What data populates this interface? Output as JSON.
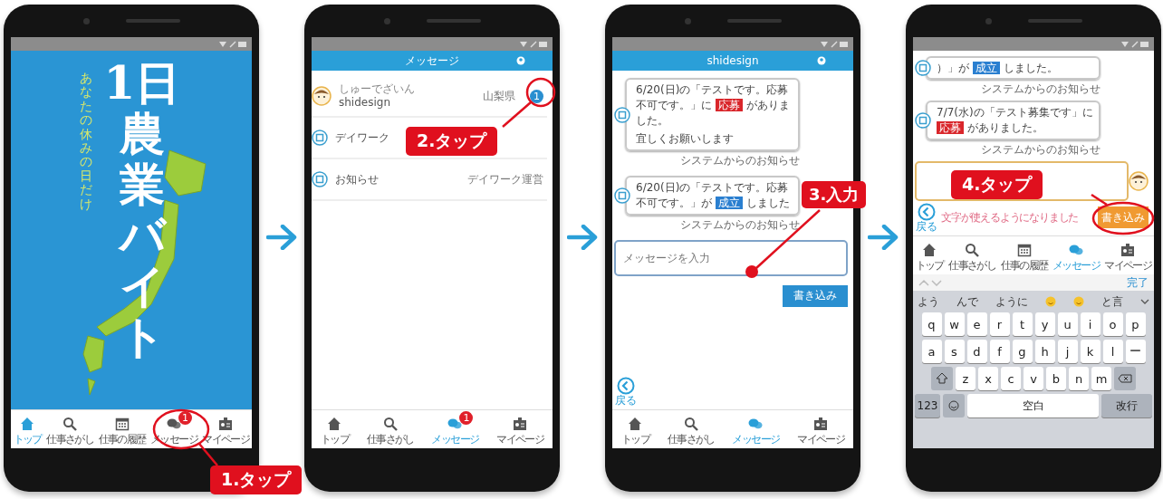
{
  "phones": [
    {
      "kind": "splash",
      "title": "1日農業バイト",
      "subtitle": "あなたの休みの日だけ",
      "nav": [
        {
          "kind": "home",
          "label": "トップ",
          "selected": true
        },
        {
          "kind": "search",
          "label": "仕事さがし",
          "selected": false
        },
        {
          "kind": "calendar",
          "label": "仕事の履歴",
          "selected": false
        },
        {
          "kind": "chat",
          "label": "メッセージ",
          "selected": false,
          "badge": "1"
        },
        {
          "kind": "profile",
          "label": "マイページ",
          "selected": false
        }
      ]
    },
    {
      "kind": "list",
      "header": "メッセージ",
      "threads": [
        {
          "kind": "person",
          "furigana": "しゅーでざいん",
          "name": "shidesign",
          "area": "山梨県",
          "badge": "1"
        },
        {
          "kind": "logo",
          "name": "デイワーク"
        },
        {
          "kind": "logo",
          "name": "お知らせ",
          "area": "デイワーク運営"
        }
      ],
      "nav": [
        {
          "kind": "home",
          "label": "トップ",
          "selected": false
        },
        {
          "kind": "search",
          "label": "仕事さがし",
          "selected": false
        },
        {
          "kind": "chat",
          "label": "メッセージ",
          "selected": true,
          "badge": "1"
        },
        {
          "kind": "profile",
          "label": "マイページ",
          "selected": false
        }
      ]
    },
    {
      "kind": "chat",
      "header": "shidesign",
      "messages": [
        {
          "parts": [
            {
              "kind": "text",
              "text": "6/20(日)の「テストです。応募不可です。」に "
            },
            {
              "kind": "tag",
              "text": "応募",
              "color": "#d9262b"
            },
            {
              "kind": "text",
              "text": " がありました。"
            }
          ],
          "note": "宜しくお願いします",
          "caption": "システムからのお知らせ"
        },
        {
          "parts": [
            {
              "kind": "text",
              "text": "6/20(日)の「テストです。応募不可です。」が "
            },
            {
              "kind": "tag",
              "text": "成立",
              "color": "#2a7fd0"
            },
            {
              "kind": "text",
              "text": " しました"
            }
          ],
          "caption": "システムからのお知らせ"
        }
      ],
      "input": {
        "placeholder": "メッセージを入力"
      },
      "send": "書き込み",
      "back": "戻る",
      "nav": [
        {
          "kind": "home",
          "label": "トップ",
          "selected": false
        },
        {
          "kind": "search",
          "label": "仕事さがし",
          "selected": false
        },
        {
          "kind": "chat",
          "label": "メッセージ",
          "selected": true
        },
        {
          "kind": "profile",
          "label": "マイページ",
          "selected": false
        }
      ]
    },
    {
      "kind": "chat_keyboard",
      "messages": [
        {
          "parts": [
            {
              "kind": "text",
              "text": "）」が "
            },
            {
              "kind": "tag",
              "text": "成立",
              "color": "#2a7fd0"
            },
            {
              "kind": "text",
              "text": " しました。"
            }
          ],
          "caption": "システムからのお知らせ"
        },
        {
          "parts": [
            {
              "kind": "text",
              "text": "7/7(水)の「テスト募集です」に "
            },
            {
              "kind": "tag",
              "text": "応募",
              "color": "#d9262b"
            },
            {
              "kind": "text",
              "text": " がありました。"
            }
          ],
          "caption": "システムからのお知らせ"
        }
      ],
      "notice": "文字が使えるようになりました",
      "send": "書き込み",
      "back": "戻る",
      "nav": [
        {
          "kind": "home",
          "label": "トップ",
          "selected": false
        },
        {
          "kind": "search",
          "label": "仕事さがし",
          "selected": false
        },
        {
          "kind": "calendar",
          "label": "仕事の履歴",
          "selected": false
        },
        {
          "kind": "chat",
          "label": "メッセージ",
          "selected": true
        },
        {
          "kind": "profile",
          "label": "マイページ",
          "selected": false
        }
      ],
      "keyboard": {
        "done": "完了",
        "suggestions": [
          {
            "kind": "text",
            "text": "よう"
          },
          {
            "kind": "text",
            "text": "んで"
          },
          {
            "kind": "text",
            "text": "ように"
          },
          {
            "kind": "emoji"
          },
          {
            "kind": "emoji"
          },
          {
            "kind": "text",
            "text": "と言"
          }
        ],
        "rows": [
          [
            "q",
            "w",
            "e",
            "r",
            "t",
            "y",
            "u",
            "i",
            "o",
            "p"
          ],
          [
            "a",
            "s",
            "d",
            "f",
            "g",
            "h",
            "j",
            "k",
            "l",
            "ー"
          ],
          [
            "z",
            "x",
            "c",
            "v",
            "b",
            "n",
            "m"
          ]
        ],
        "number_key": "123",
        "space": "空白",
        "return": "改行"
      }
    }
  ],
  "callouts": [
    {
      "label": "1.タップ"
    },
    {
      "label": "2.タップ"
    },
    {
      "label": "3.入力"
    },
    {
      "label": "4.タップ"
    }
  ]
}
